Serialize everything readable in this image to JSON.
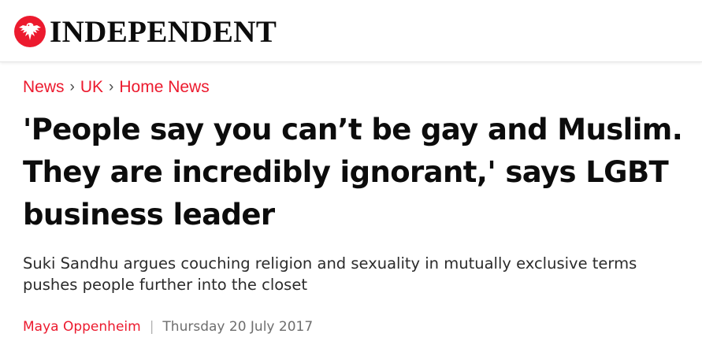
{
  "header": {
    "brand": "INDEPENDENT",
    "logo_icon": "eagle-icon",
    "brand_color": "#ec1a2e"
  },
  "breadcrumb": {
    "items": [
      "News",
      "UK",
      "Home News"
    ],
    "separator": "›"
  },
  "article": {
    "headline": "'People say you can’t be gay and Muslim. They are incredibly ignorant,' says LGBT business leader",
    "standfirst": "Suki Sandhu argues couching religion and sexuality in mutually exclusive terms pushes people further into the closet",
    "author": "Maya Oppenheim",
    "byline_separator": "|",
    "date": "Thursday 20 July 2017"
  },
  "colors": {
    "accent": "#ec1a2e",
    "text": "#0c0c0c",
    "muted": "#6e6e6e"
  }
}
